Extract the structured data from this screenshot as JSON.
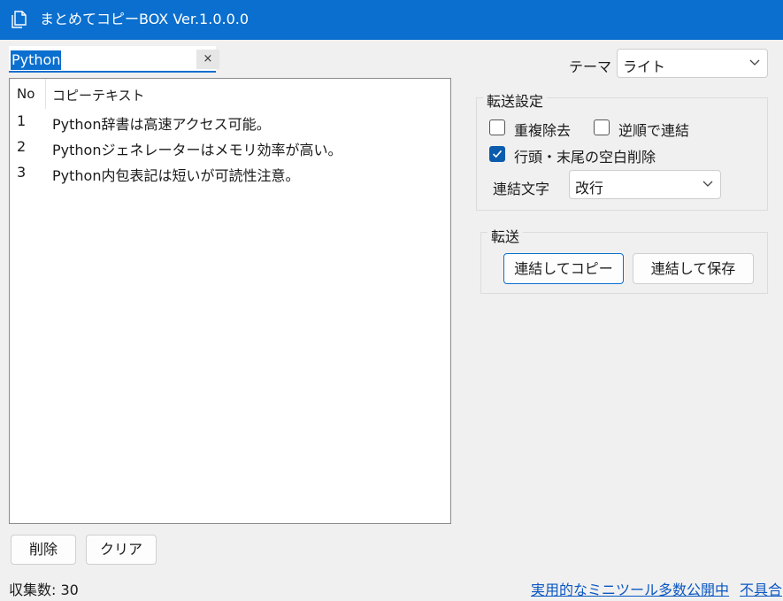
{
  "window": {
    "title": "まとめてコピーBOX Ver.1.0.0.0",
    "icon": "document-copy-icon",
    "accent": "#0b6fcf"
  },
  "search": {
    "value": "Python",
    "clear_label": "×"
  },
  "list": {
    "columns": [
      "No",
      "コピーテキスト"
    ],
    "rows": [
      {
        "no": "1",
        "text": "Python辞書は高速アクセス可能。"
      },
      {
        "no": "2",
        "text": "Pythonジェネレーターはメモリ効率が高い。"
      },
      {
        "no": "3",
        "text": "Python内包表記は短いが可読性注意。"
      }
    ]
  },
  "buttons": {
    "delete": "削除",
    "clear": "クリア"
  },
  "status": {
    "count": "収集数: 30"
  },
  "links": {
    "tools": "実用的なミニツール多数公開中",
    "bug": "不具合"
  },
  "theme": {
    "label": "テーマ",
    "value": "ライト"
  },
  "transfer_settings": {
    "title": "転送設定",
    "dedupe": {
      "label": "重複除去",
      "checked": false
    },
    "reverse": {
      "label": "逆順で連結",
      "checked": false
    },
    "trim": {
      "label": "行頭・末尾の空白削除",
      "checked": true
    },
    "joiner_label": "連結文字",
    "joiner_value": "改行"
  },
  "transfer": {
    "title": "転送",
    "copy_button": "連結してコピー",
    "save_button": "連結して保存"
  }
}
